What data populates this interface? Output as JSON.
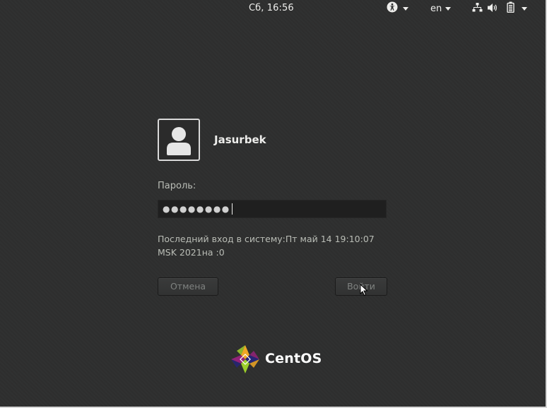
{
  "topbar": {
    "clock": "Сб, 16:56",
    "language": "en"
  },
  "login": {
    "username": "Jasurbek",
    "password_label": "Пароль:",
    "password_masked": "●●●●●●●●",
    "last_login_message_line1": "Последний вход в систему:Пт май 14 19:10:07",
    "last_login_message_line2": "MSK 2021на :0",
    "cancel_label": "Отмена",
    "signin_label": "Войти"
  },
  "branding": {
    "logo_text": "CentOS"
  }
}
